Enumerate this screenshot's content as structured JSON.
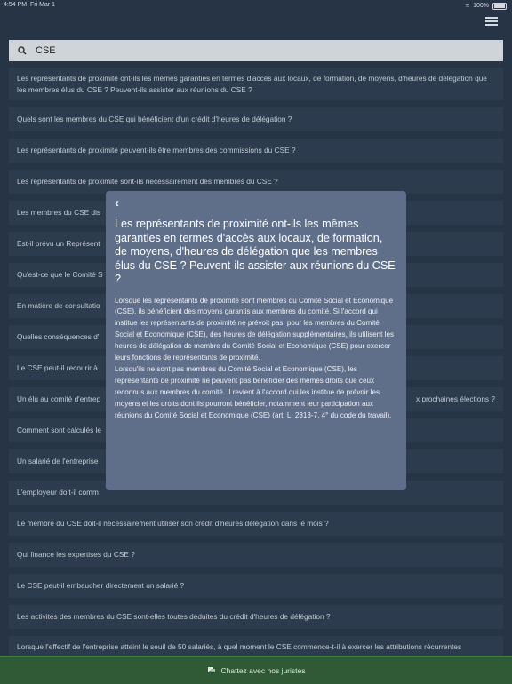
{
  "status_bar": {
    "time": "4:54 PM",
    "date": "Fri Mar 1",
    "battery": "100%"
  },
  "search": {
    "value": "CSE"
  },
  "questions": [
    {
      "text": "Les représentants de proximité ont-ils les mêmes garanties en termes d'accès aux locaux, de formation, de moyens, d'heures de délégation que les membres élus du CSE ? Peuvent-ils assister aux réunions du CSE ?"
    },
    {
      "text": "Quels sont les membres du CSE qui bénéficient d'un crédit d'heures de délégation ?"
    },
    {
      "text": "Les représentants de proximité peuvent-ils être membres des commissions du CSE ?"
    },
    {
      "text": "Les représentants de proximité sont-ils nécessairement des membres du CSE ?"
    },
    {
      "text": "Les membres du CSE dis"
    },
    {
      "text": "Est-il prévu un Représent"
    },
    {
      "text": "Qu'est-ce que le Comité S"
    },
    {
      "text": "En matière de consultatio"
    },
    {
      "text": "Quelles conséquences d'"
    },
    {
      "text": "Le CSE peut-il recourir à"
    },
    {
      "text": "Un élu au comité d'entrep",
      "tail": "x prochaines élections ?"
    },
    {
      "text": "Comment sont calculés le"
    },
    {
      "text": "Un salarié de l'entreprise"
    },
    {
      "text": "L'employeur doit-il comm"
    },
    {
      "text": "Le membre du CSE doit-il nécessairement utiliser son crédit d'heures délégation dans le mois ?"
    },
    {
      "text": "Qui finance les expertises du CSE ?"
    },
    {
      "text": "Le CSE peut-il embaucher directement un salarié ?"
    },
    {
      "text": "Les activités des membres du CSE sont-elles toutes déduites du crédit d'heures de délégation ?"
    },
    {
      "text": "Lorsque l'effectif de l'entreprise atteint le seuil de 50 salariés, à quel moment le CSE commence-t-il à exercer les attributions récurrentes d'information et de consultation ?"
    }
  ],
  "modal": {
    "title": "Les représentants de proximité ont-ils les mêmes garanties en termes d'accès aux locaux, de formation, de moyens, d'heures de délégation que les membres élus du CSE ? Peuvent-ils assister aux réunions du CSE ?",
    "paragraph_1": "Lorsque les représentants de proximité sont membres du Comité Social et Economique (CSE), ils bénéficient des moyens garantis aux membres du comité. Si l'accord qui institue les représentants de proximité ne prévoit pas, pour les membres du Comité Social et Economique (CSE), des heures de délégation supplémentaires, ils utilisent les heures de délégation de membre du Comité Social et Economique (CSE) pour exercer leurs fonctions de représentants de proximité.",
    "paragraph_2": "Lorsqu'ils ne sont pas membres du Comité Social et Economique (CSE), les représentants de proximité ne peuvent pas bénéficier des mêmes droits que ceux reconnus aux membres du comité. Il revient à l'accord qui les institue de prévoir les moyens et les droits dont ils pourront bénéficier, notamment leur participation aux réunions du Comité Social et Economique (CSE) (art. L. 2313-7, 4° du code du travail)."
  },
  "bottom_bar": {
    "label": "Chattez avec nos juristes"
  }
}
